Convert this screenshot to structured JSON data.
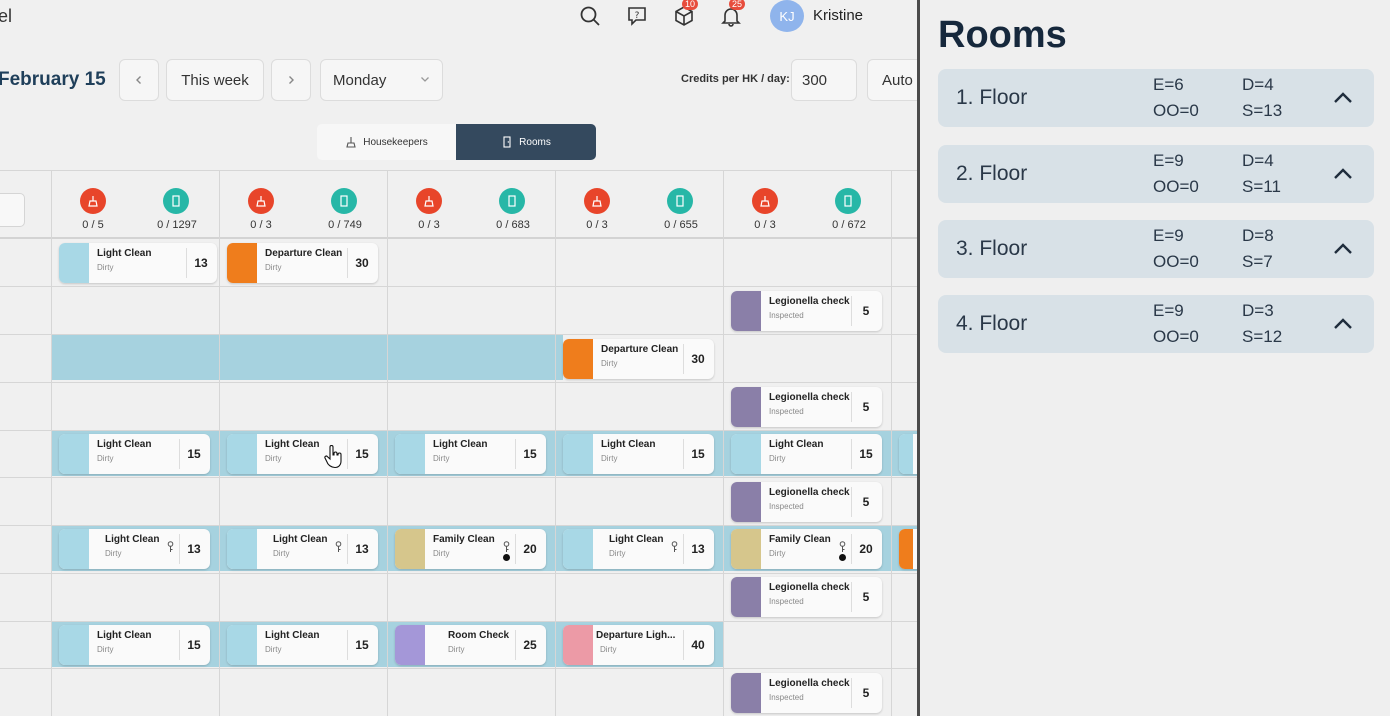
{
  "header": {
    "app_title_fragment": "el",
    "user_initials": "KJ",
    "user_name": "Kristine",
    "badge_packages": "10",
    "badge_notifications": "25"
  },
  "toolbar": {
    "date_label": "February 15",
    "this_week_label": "This week",
    "day_select_value": "Monday",
    "credits_label": "Credits per HK / day:",
    "credits_value": "300",
    "auto_label": "Auto"
  },
  "view_toggle": {
    "housekeepers_label": "Housekeepers",
    "rooms_label": "Rooms",
    "active": "Rooms"
  },
  "days": [
    {
      "red_count": "0 / 5",
      "teal_count": "0 / 1297"
    },
    {
      "red_count": "0 / 3",
      "teal_count": "0 / 749"
    },
    {
      "red_count": "0 / 3",
      "teal_count": "0 / 683"
    },
    {
      "red_count": "0 / 3",
      "teal_count": "0 / 655"
    },
    {
      "red_count": "0 / 3",
      "teal_count": "0 / 672"
    }
  ],
  "tasks": [
    {
      "title": "Light Clean",
      "status": "Dirty",
      "credits": "13",
      "color": "#a8d8e6"
    },
    {
      "title": "Departure Clean",
      "status": "Dirty",
      "credits": "30",
      "color": "#ef7d1c"
    },
    {
      "title": "Legionella check",
      "status": "Inspected",
      "credits": "5",
      "color": "#8a7fa8"
    },
    {
      "title": "Departure Clean",
      "status": "Dirty",
      "credits": "30",
      "color": "#ef7d1c"
    },
    {
      "title": "Legionella check",
      "status": "Inspected",
      "credits": "5",
      "color": "#8a7fa8"
    },
    {
      "title": "Light Clean",
      "status": "Dirty",
      "credits": "15",
      "color": "#a8d8e6"
    },
    {
      "title": "Light Clean",
      "status": "Dirty",
      "credits": "15",
      "color": "#a8d8e6"
    },
    {
      "title": "Light Clean",
      "status": "Dirty",
      "credits": "15",
      "color": "#a8d8e6"
    },
    {
      "title": "Light Clean",
      "status": "Dirty",
      "credits": "15",
      "color": "#a8d8e6"
    },
    {
      "title": "Light Clean",
      "status": "Dirty",
      "credits": "15",
      "color": "#a8d8e6"
    },
    {
      "title": "Legionella check",
      "status": "Inspected",
      "credits": "5",
      "color": "#8a7fa8"
    },
    {
      "title": "Light Clean",
      "status": "Dirty",
      "credits": "13",
      "color": "#a8d8e6"
    },
    {
      "title": "Light Clean",
      "status": "Dirty",
      "credits": "13",
      "color": "#a8d8e6"
    },
    {
      "title": "Family Clean",
      "status": "Dirty",
      "credits": "20",
      "color": "#d6c68c"
    },
    {
      "title": "Light Clean",
      "status": "Dirty",
      "credits": "13",
      "color": "#a8d8e6"
    },
    {
      "title": "Family Clean",
      "status": "Dirty",
      "credits": "20",
      "color": "#d6c68c"
    },
    {
      "title": "Legionella check",
      "status": "Inspected",
      "credits": "5",
      "color": "#8a7fa8"
    },
    {
      "title": "Light Clean",
      "status": "Dirty",
      "credits": "15",
      "color": "#a8d8e6"
    },
    {
      "title": "Light Clean",
      "status": "Dirty",
      "credits": "15",
      "color": "#a8d8e6"
    },
    {
      "title": "Room Check",
      "status": "Dirty",
      "credits": "25",
      "color": "#a497d8"
    },
    {
      "title": "Departure Ligh...",
      "status": "Dirty",
      "credits": "40",
      "color": "#ec9aa6"
    },
    {
      "title": "Legionella check",
      "status": "Inspected",
      "credits": "5",
      "color": "#8a7fa8"
    }
  ],
  "rooms_panel": {
    "title": "Rooms",
    "floors": [
      {
        "name": "1. Floor",
        "e": "E=6",
        "d": "D=4",
        "oo": "OO=0",
        "s": "S=13"
      },
      {
        "name": "2. Floor",
        "e": "E=9",
        "d": "D=4",
        "oo": "OO=0",
        "s": "S=11"
      },
      {
        "name": "3. Floor",
        "e": "E=9",
        "d": "D=8",
        "oo": "OO=0",
        "s": "S=7"
      },
      {
        "name": "4. Floor",
        "e": "E=9",
        "d": "D=3",
        "oo": "OO=0",
        "s": "S=12"
      }
    ]
  },
  "colors": {
    "accent_dark": "#34495e",
    "danger": "#e8452a",
    "teal": "#27b7a7",
    "row_band": "#a6d2df"
  },
  "icons": [
    "search-icon",
    "help-icon",
    "package-icon",
    "bell-icon",
    "chevron-left-icon",
    "chevron-right-icon",
    "chevron-down-icon",
    "broom-icon",
    "door-icon",
    "key-icon",
    "chevron-up-icon",
    "pointer-cursor-icon"
  ]
}
